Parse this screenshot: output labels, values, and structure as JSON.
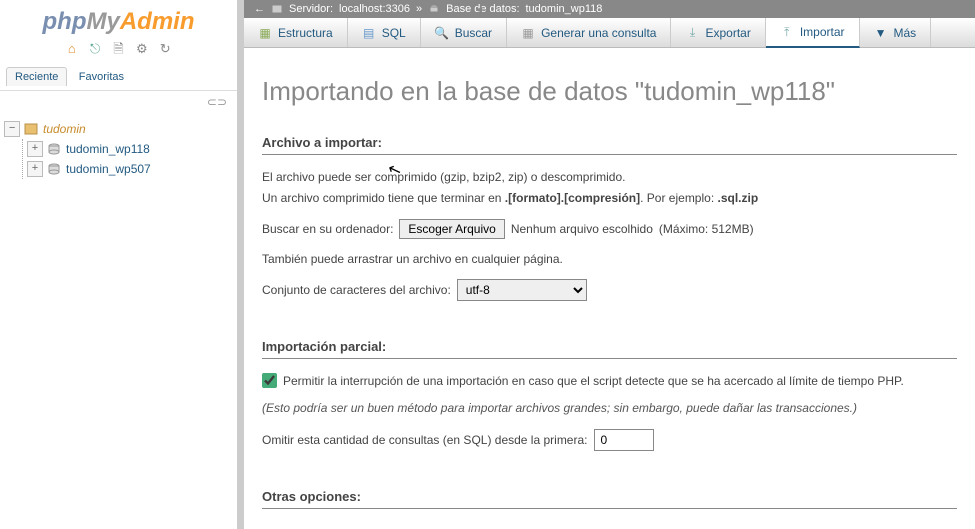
{
  "logo": {
    "php": "php",
    "my": "My",
    "admin": "Admin"
  },
  "recent": {
    "tab1": "Reciente",
    "tab2": "Favoritas"
  },
  "tree": {
    "root": "tudomin",
    "items": [
      "tudomin_wp118",
      "tudomin_wp507"
    ]
  },
  "breadcrumb": {
    "server_label": "Servidor:",
    "server_value": "localhost:3306",
    "sep": "»",
    "db_label": "Base de datos:",
    "db_value": "tudomin_wp118"
  },
  "tabs": {
    "structure": "Estructura",
    "sql": "SQL",
    "search": "Buscar",
    "query": "Generar una consulta",
    "export": "Exportar",
    "import": "Importar",
    "more": "Más"
  },
  "page": {
    "title": "Importando en la base de datos \"tudomin_wp118\""
  },
  "section_file": {
    "heading": "Archivo a importar:",
    "line1": "El archivo puede ser comprimido (gzip, bzip2, zip) o descomprimido.",
    "line2a": "Un archivo comprimido tiene que terminar en ",
    "line2b": ".[formato].[compresión]",
    "line2c": ". Por ejemplo: ",
    "line2d": ".sql.zip",
    "browse_label": "Buscar en su ordenador:",
    "file_button": "Escoger Arquivo",
    "no_file": "Nenhum arquivo escolhido",
    "max": "(Máximo: 512MB)",
    "drag": "También puede arrastrar un archivo en cualquier página.",
    "charset_label": "Conjunto de caracteres del archivo:",
    "charset_value": "utf-8"
  },
  "section_partial": {
    "heading": "Importación parcial:",
    "allow": "Permitir la interrupción de una importación en caso que el script detecte que se ha acercado al límite de tiempo PHP.",
    "note": "(Esto podría ser un buen método para importar archivos grandes; sin embargo, puede dañar las transacciones.)",
    "skip_label": "Omitir esta cantidad de consultas (en SQL) desde la primera:",
    "skip_value": "0"
  },
  "section_other": {
    "heading": "Otras opciones:"
  }
}
